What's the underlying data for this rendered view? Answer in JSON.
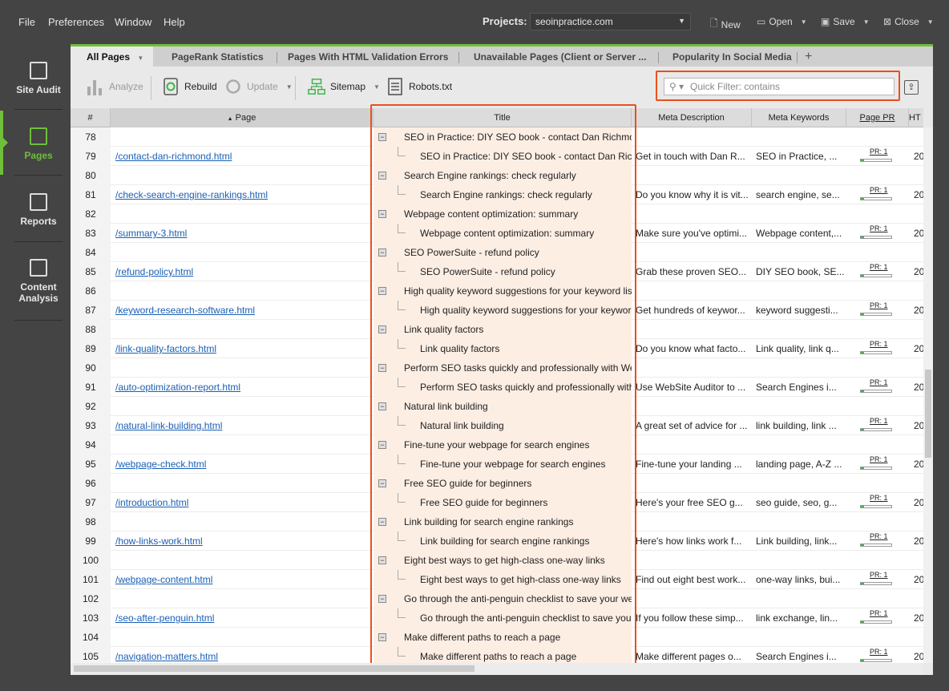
{
  "menu": {
    "file": "File",
    "preferences": "Preferences",
    "window": "Window",
    "help": "Help"
  },
  "projects": {
    "label": "Projects:",
    "value": "seoinpractice.com"
  },
  "top_buttons": {
    "new": "New",
    "open": "Open",
    "save": "Save",
    "close": "Close"
  },
  "nav": {
    "site_audit": "Site Audit",
    "pages": "Pages",
    "reports": "Reports",
    "content_analysis_1": "Content",
    "content_analysis_2": "Analysis"
  },
  "tabs": {
    "all_pages": "All Pages",
    "pagerank": "PageRank Statistics",
    "html_errors": "Pages With HTML Validation Errors",
    "unavailable": "Unavailable Pages (Client or Server ...",
    "social": "Popularity In Social Media"
  },
  "toolbar": {
    "analyze": "Analyze",
    "rebuild": "Rebuild",
    "update": "Update",
    "sitemap": "Sitemap",
    "robots": "Robots.txt"
  },
  "filter": {
    "placeholder": "Quick Filter: contains",
    "value": ""
  },
  "columns": {
    "num": "#",
    "page": "Page",
    "title": "Title",
    "meta": "Meta Description",
    "keywords": "Meta Keywords",
    "pr": "Page PR",
    "ht": "HT"
  },
  "rows": [
    {
      "num": "78",
      "page": "",
      "title": "SEO in Practice: DIY SEO book - contact Dan Richmond",
      "meta": "",
      "kw": "",
      "pr": "",
      "ht": "",
      "parent": true
    },
    {
      "num": "79",
      "page": "/contact-dan-richmond.html",
      "title": "SEO in Practice: DIY SEO book - contact Dan Richmond",
      "meta": "Get in touch with Dan R...",
      "kw": "SEO in Practice, ...",
      "pr": "PR: 1",
      "ht": "20",
      "parent": false
    },
    {
      "num": "80",
      "page": "",
      "title": "Search Engine rankings: check regularly",
      "meta": "",
      "kw": "",
      "pr": "",
      "ht": "",
      "parent": true
    },
    {
      "num": "81",
      "page": "/check-search-engine-rankings.html",
      "title": "Search Engine rankings: check regularly",
      "meta": "Do you know why it is vit...",
      "kw": "search engine, se...",
      "pr": "PR: 1",
      "ht": "20",
      "parent": false
    },
    {
      "num": "82",
      "page": "",
      "title": "Webpage content optimization: summary",
      "meta": "",
      "kw": "",
      "pr": "",
      "ht": "",
      "parent": true
    },
    {
      "num": "83",
      "page": "/summary-3.html",
      "title": "Webpage content optimization: summary",
      "meta": "Make sure you've optimi...",
      "kw": "Webpage content,...",
      "pr": "PR: 1",
      "ht": "20",
      "parent": false
    },
    {
      "num": "84",
      "page": "",
      "title": "SEO PowerSuite - refund policy",
      "meta": "",
      "kw": "",
      "pr": "",
      "ht": "",
      "parent": true
    },
    {
      "num": "85",
      "page": "/refund-policy.html",
      "title": "SEO PowerSuite - refund policy",
      "meta": "Grab these proven SEO...",
      "kw": "DIY SEO book, SE...",
      "pr": "PR: 1",
      "ht": "20",
      "parent": false
    },
    {
      "num": "86",
      "page": "",
      "title": "High quality keyword suggestions for your keyword list",
      "meta": "",
      "kw": "",
      "pr": "",
      "ht": "",
      "parent": true
    },
    {
      "num": "87",
      "page": "/keyword-research-software.html",
      "title": "High quality keyword suggestions for your keyword list",
      "meta": "Get hundreds of keywor...",
      "kw": "keyword suggesti...",
      "pr": "PR: 1",
      "ht": "20",
      "parent": false
    },
    {
      "num": "88",
      "page": "",
      "title": "Link quality factors",
      "meta": "",
      "kw": "",
      "pr": "",
      "ht": "",
      "parent": true
    },
    {
      "num": "89",
      "page": "/link-quality-factors.html",
      "title": "Link quality factors",
      "meta": "Do you know what facto...",
      "kw": "Link quality, link q...",
      "pr": "PR: 1",
      "ht": "20",
      "parent": false
    },
    {
      "num": "90",
      "page": "",
      "title": "Perform SEO tasks quickly and professionally with WebSite Auditor",
      "meta": "",
      "kw": "",
      "pr": "",
      "ht": "",
      "parent": true
    },
    {
      "num": "91",
      "page": "/auto-optimization-report.html",
      "title": "Perform SEO tasks quickly and professionally with WebSite Auditor",
      "meta": "Use WebSite Auditor to ...",
      "kw": "Search Engines i...",
      "pr": "PR: 1",
      "ht": "20",
      "parent": false
    },
    {
      "num": "92",
      "page": "",
      "title": "Natural link building",
      "meta": "",
      "kw": "",
      "pr": "",
      "ht": "",
      "parent": true
    },
    {
      "num": "93",
      "page": "/natural-link-building.html",
      "title": "Natural link building",
      "meta": "A great set of advice for ...",
      "kw": "link building, link ...",
      "pr": "PR: 1",
      "ht": "20",
      "parent": false
    },
    {
      "num": "94",
      "page": "",
      "title": "Fine-tune your webpage for search engines",
      "meta": "",
      "kw": "",
      "pr": "",
      "ht": "",
      "parent": true
    },
    {
      "num": "95",
      "page": "/webpage-check.html",
      "title": "Fine-tune your webpage for search engines",
      "meta": "Fine-tune your landing ...",
      "kw": "landing page, A-Z ...",
      "pr": "PR: 1",
      "ht": "20",
      "parent": false
    },
    {
      "num": "96",
      "page": "",
      "title": "Free SEO guide for beginners",
      "meta": "",
      "kw": "",
      "pr": "",
      "ht": "",
      "parent": true
    },
    {
      "num": "97",
      "page": "/introduction.html",
      "title": "Free SEO guide for beginners",
      "meta": "Here's your free SEO g...",
      "kw": "seo guide, seo, g...",
      "pr": "PR: 1",
      "ht": "20",
      "parent": false
    },
    {
      "num": "98",
      "page": "",
      "title": "Link building for search engine rankings",
      "meta": "",
      "kw": "",
      "pr": "",
      "ht": "",
      "parent": true
    },
    {
      "num": "99",
      "page": "/how-links-work.html",
      "title": "Link building for search engine rankings",
      "meta": "Here's how links work f...",
      "kw": "Link building, link...",
      "pr": "PR: 1",
      "ht": "20",
      "parent": false
    },
    {
      "num": "100",
      "page": "",
      "title": "Eight best ways to get high-class one-way links",
      "meta": "",
      "kw": "",
      "pr": "",
      "ht": "",
      "parent": true
    },
    {
      "num": "101",
      "page": "/webpage-content.html",
      "title": "Eight best ways to get high-class one-way links",
      "meta": "Find out eight best work...",
      "kw": "one-way links, bui...",
      "pr": "PR: 1",
      "ht": "20",
      "parent": false
    },
    {
      "num": "102",
      "page": "",
      "title": "Go through the anti-penguin checklist to save your website",
      "meta": "",
      "kw": "",
      "pr": "",
      "ht": "",
      "parent": true
    },
    {
      "num": "103",
      "page": "/seo-after-penguin.html",
      "title": "Go through the anti-penguin checklist to save your website",
      "meta": "If you follow these simp...",
      "kw": "link exchange, lin...",
      "pr": "PR: 1",
      "ht": "20",
      "parent": false
    },
    {
      "num": "104",
      "page": "",
      "title": "Make different paths to reach a page",
      "meta": "",
      "kw": "",
      "pr": "",
      "ht": "",
      "parent": true
    },
    {
      "num": "105",
      "page": "/navigation-matters.html",
      "title": "Make different paths to reach a page",
      "meta": "Make different pages o...",
      "kw": "Search Engines i...",
      "pr": "PR: 1",
      "ht": "20",
      "parent": false
    }
  ],
  "colors": {
    "accent": "#6fbf3a",
    "highlight": "#e8501e",
    "link": "#1a5fb4"
  },
  "pr_level": 0.1
}
